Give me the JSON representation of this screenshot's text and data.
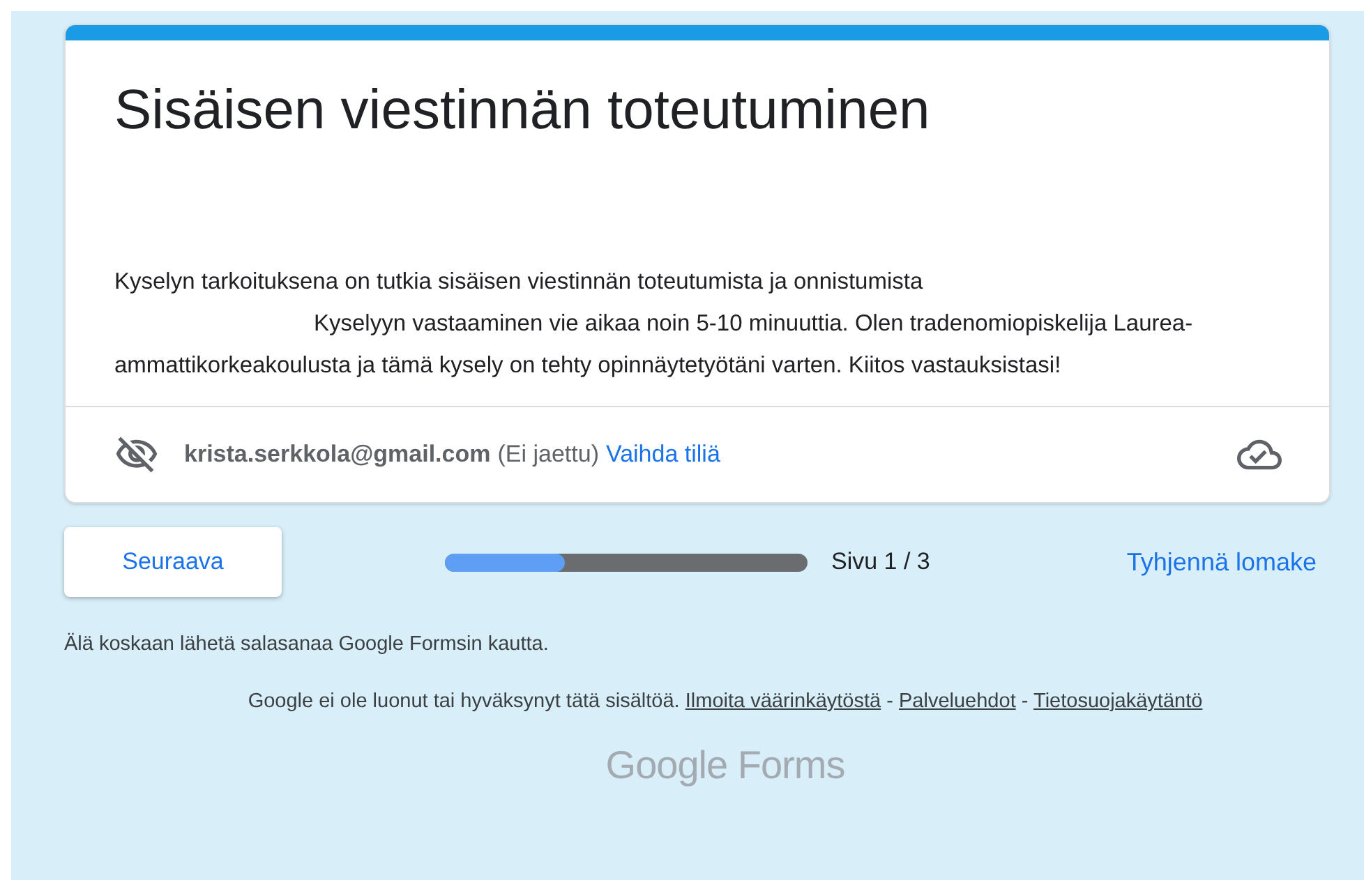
{
  "form": {
    "title": "Sisäisen viestinnän toteutuminen",
    "description_lines": [
      "Kyselyn tarkoituksena on tutkia sisäisen viestinnän toteutumista ja onnistumista",
      "Kyselyyn vastaaminen vie aikaa noin 5-10 minuuttia. Olen tradenomiopiskelija Laurea-ammattikorkeakoulusta ja tämä kysely on tehty opinnäytetyötäni varten. Kiitos vastauksistasi!"
    ],
    "account": {
      "email": "krista.serkkola@gmail.com",
      "note": "(Ei jaettu)",
      "switch_link": "Vaihda tiliä"
    }
  },
  "navigation": {
    "next_button": "Seuraava",
    "progress": {
      "level": 0.33
    },
    "page_label": "Sivu 1 / 3",
    "clear_link": "Tyhjennä lomake"
  },
  "footer": {
    "warning": "Älä koskaan lähetä salasanaa Google Formsin kautta.",
    "disclaimer": "Google ei ole luonut tai hyväksynyt tätä sisältöä.",
    "links": [
      "Ilmoita väärinkäytöstä",
      "Palveluehdot",
      "Tietosuojakäytäntö"
    ],
    "separator": "-",
    "logo_google": "Google",
    "logo_forms": "Forms"
  }
}
